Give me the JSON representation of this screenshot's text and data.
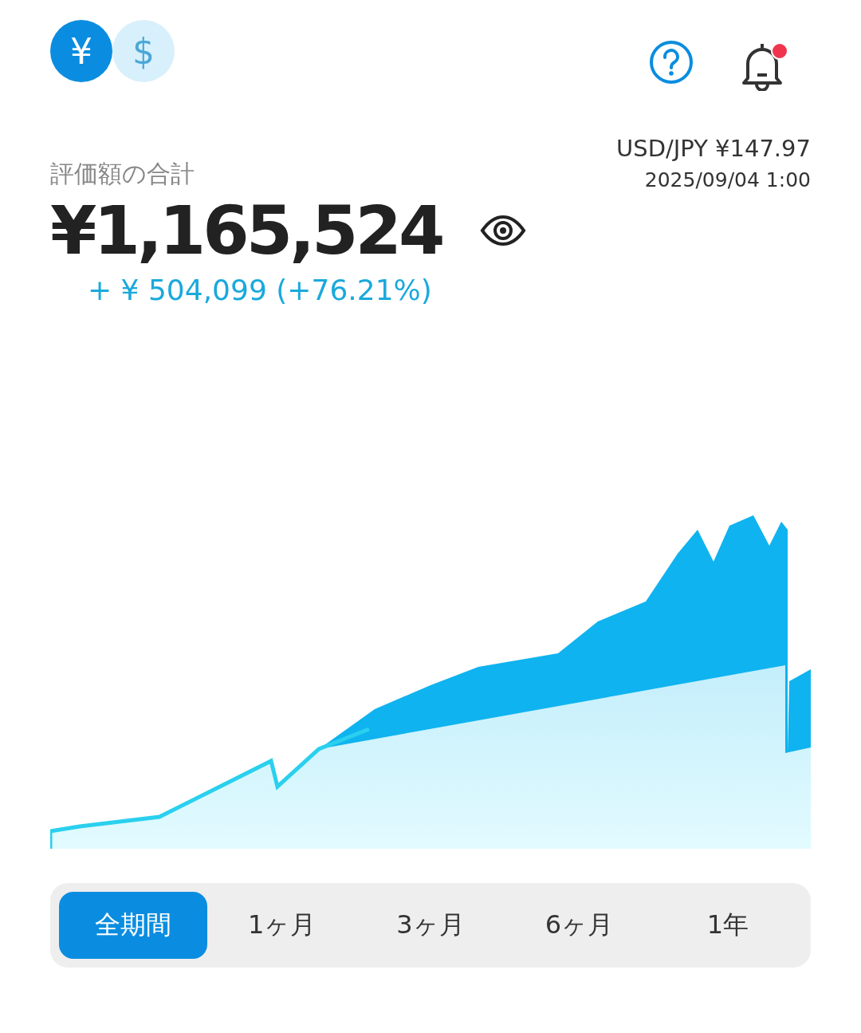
{
  "currencies": [
    {
      "symbol": "¥",
      "selected": true
    },
    {
      "symbol": "$",
      "selected": false
    }
  ],
  "notifications": {
    "unread": true
  },
  "rate": {
    "pair": "USD/JPY ¥147.97",
    "time": "2025/09/04 1:00"
  },
  "summary": {
    "label": "評価額の合計",
    "total": "¥1,165,524",
    "gain": "+ ¥ 504,099 (+76.21%)"
  },
  "periods": [
    {
      "label": "全期間",
      "selected": true
    },
    {
      "label": "1ヶ月",
      "selected": false
    },
    {
      "label": "3ヶ月",
      "selected": false
    },
    {
      "label": "6ヶ月",
      "selected": false
    },
    {
      "label": "1年",
      "selected": false
    }
  ]
}
